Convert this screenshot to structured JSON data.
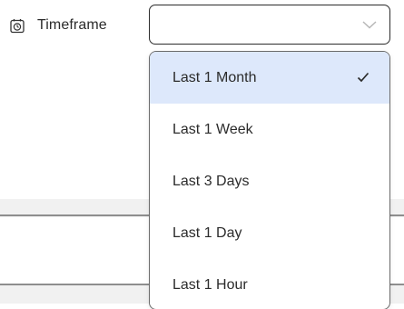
{
  "filter": {
    "label": "Timeframe",
    "icon": "timer-icon",
    "selected_value": ""
  },
  "dropdown": {
    "selected_index": 0,
    "options": [
      {
        "label": "Last 1 Month",
        "selected": true
      },
      {
        "label": "Last 1 Week",
        "selected": false
      },
      {
        "label": "Last 3 Days",
        "selected": false
      },
      {
        "label": "Last 1 Day",
        "selected": false
      },
      {
        "label": "Last 1 Hour",
        "selected": false
      }
    ]
  },
  "colors": {
    "selected_bg": "#dde8fb",
    "border": "#2c2c2c",
    "text": "#2b2b2b"
  }
}
